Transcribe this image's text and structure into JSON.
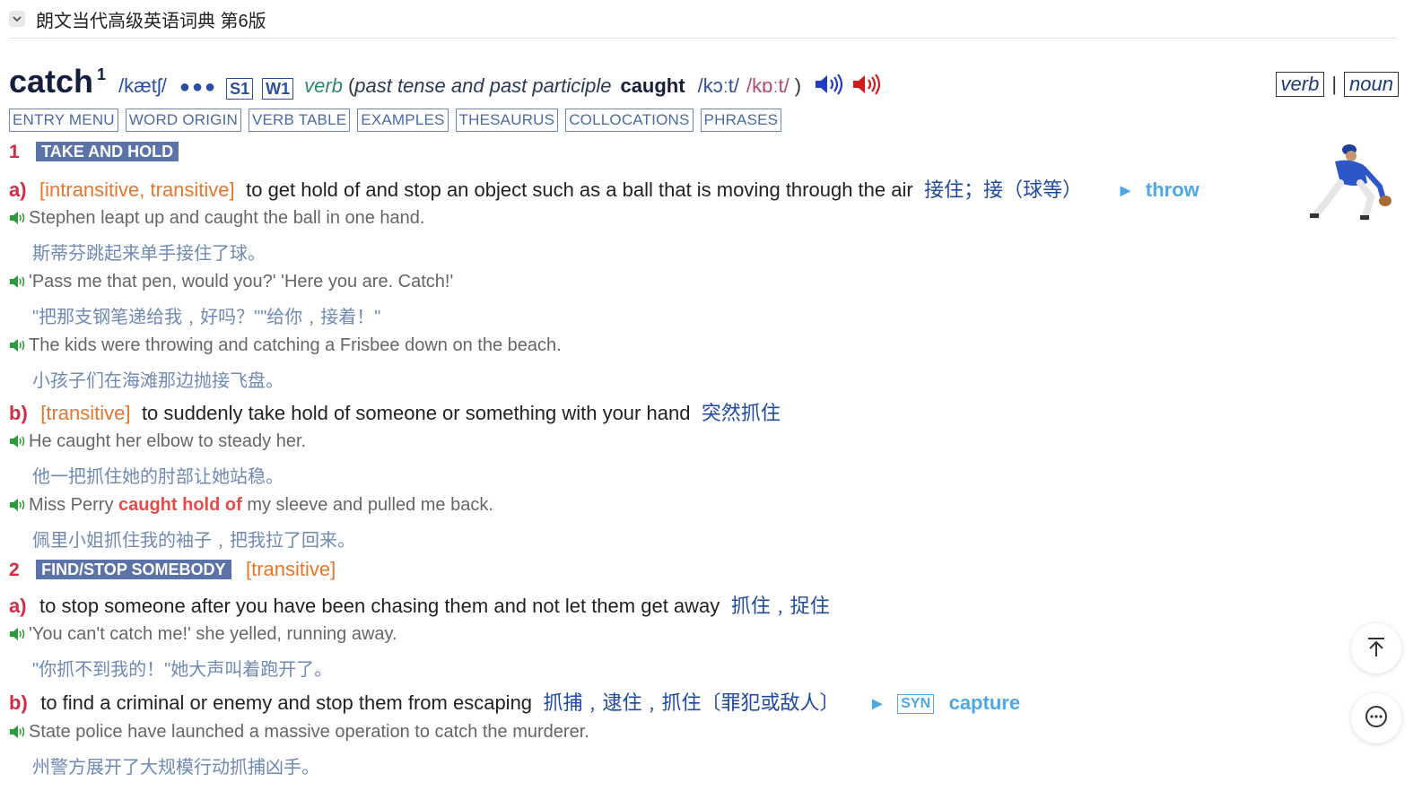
{
  "dictionary": {
    "title": "朗文当代高级英语词典 第6版"
  },
  "entry": {
    "headword": "catch",
    "homnum": "1",
    "pron": "/kætʃ/",
    "freq_dots": "●●●",
    "badges": [
      "S1",
      "W1"
    ],
    "pos": "verb",
    "paren_open": "(",
    "grammar_note": "past tense and past participle",
    "past_form": "caught",
    "pron_uk": "/kɔːt/",
    "pron_us": "/kɒːt/",
    "paren_close": ")",
    "pos_links": [
      "verb",
      "noun"
    ],
    "pos_sep": "|"
  },
  "nav_tabs": [
    "ENTRY MENU",
    "WORD ORIGIN",
    "VERB TABLE",
    "EXAMPLES",
    "THESAURUS",
    "COLLOCATIONS",
    "PHRASES"
  ],
  "senses": [
    {
      "num": "1",
      "signpost": "TAKE AND HOLD",
      "subsenses": [
        {
          "letter": "a)",
          "gram": "[intransitive, transitive]",
          "def": "to get hold of and stop an object such as a ball that is moving through the air",
          "zh": "接住；接（球等）",
          "xref_arrow": "►",
          "xref": "throw",
          "examples": [
            {
              "en": "Stephen leapt up and caught the ball in one hand.",
              "zh": "斯蒂芬跳起来单手接住了球。"
            },
            {
              "en": "'Pass me that pen, would you?' 'Here you are. Catch!'",
              "zh": "\"把那支钢笔递给我﹐好吗？\"\"给你﹐接着！\""
            },
            {
              "en": "The kids were throwing and catching a Frisbee down on the beach.",
              "zh": "小孩子们在海滩那边抛接飞盘。"
            }
          ]
        },
        {
          "letter": "b)",
          "gram": "[transitive]",
          "def": "to suddenly take hold of someone or something with your hand",
          "zh": "突然抓住",
          "examples": [
            {
              "en": "He caught her elbow to steady her.",
              "zh": "他一把抓住她的肘部让她站稳。"
            },
            {
              "en_pre": "Miss Perry ",
              "en_collo": "caught hold of",
              "en_post": " my sleeve and pulled me back.",
              "zh": "佩里小姐抓住我的袖子﹐把我拉了回来。"
            }
          ]
        }
      ]
    },
    {
      "num": "2",
      "signpost": "FIND/STOP SOMEBODY",
      "gram": "[transitive]",
      "subsenses": [
        {
          "letter": "a)",
          "def": "to stop someone after you have been chasing them and not let them get away",
          "zh": "抓住﹐捉住",
          "examples": [
            {
              "en": "'You can't catch me!' she yelled, running away.",
              "zh": "\"你抓不到我的！\"她大声叫着跑开了。"
            }
          ]
        },
        {
          "letter": "b)",
          "def": "to find a criminal or enemy and stop them from escaping",
          "zh": "抓捕﹐逮住﹐抓住〔罪犯或敌人〕",
          "xref_arrow": "►",
          "syn": "SYN",
          "xref": "capture",
          "examples": [
            {
              "en": "State police have launched a massive operation to catch the murderer.",
              "zh": "州警方展开了大规模行动抓捕凶手。"
            }
          ]
        }
      ]
    }
  ],
  "colors": {
    "sense_red": "#d42a44",
    "signpost_bg": "#5b73a8",
    "gram_orange": "#e5762b",
    "xref_blue": "#4ea8e6",
    "zh_blue": "#1f4aa0",
    "example_green_speaker": "#2e9a3e"
  },
  "icons": {
    "header": "chevron-down-icon",
    "uk_speaker": "speaker-icon-blue",
    "us_speaker": "speaker-icon-red",
    "example_speaker": "speaker-icon-green",
    "scroll_top": "arrow-up-to-top-icon",
    "more": "more-dots-icon"
  }
}
